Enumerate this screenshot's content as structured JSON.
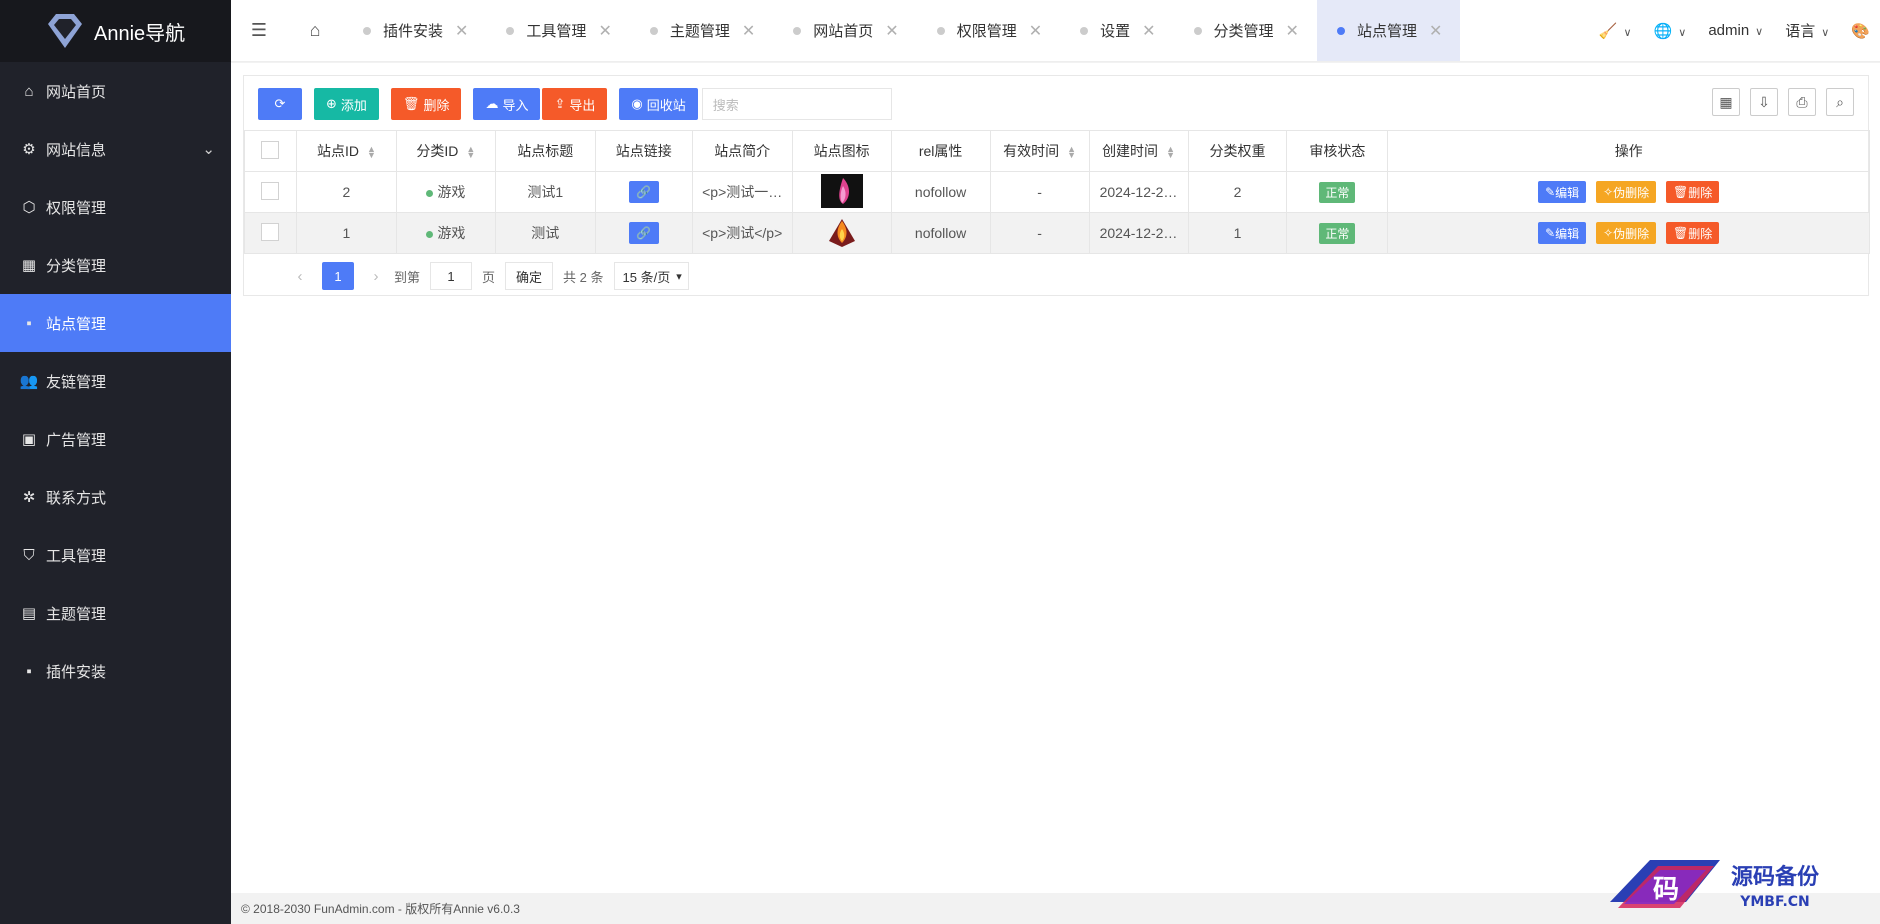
{
  "app": {
    "title": "Annie导航"
  },
  "sidebar": {
    "items": [
      {
        "label": "网站首页",
        "icon": "home-icon"
      },
      {
        "label": "网站信息",
        "icon": "gear-icon"
      },
      {
        "label": "权限管理",
        "icon": "cube-icon"
      },
      {
        "label": "分类管理",
        "icon": "apps-icon"
      },
      {
        "label": "站点管理",
        "icon": "windows-icon",
        "active": true
      },
      {
        "label": "友链管理",
        "icon": "users-icon"
      },
      {
        "label": "广告管理",
        "icon": "image-icon"
      },
      {
        "label": "联系方式",
        "icon": "star-icon"
      },
      {
        "label": "工具管理",
        "icon": "shield-icon"
      },
      {
        "label": "主题管理",
        "icon": "layout-icon"
      },
      {
        "label": "插件安装",
        "icon": "windows-icon"
      }
    ]
  },
  "tabs": [
    "插件安装",
    "工具管理",
    "主题管理",
    "网站首页",
    "权限管理",
    "设置",
    "分类管理",
    "站点管理"
  ],
  "header": {
    "user": "admin",
    "lang": "语言"
  },
  "toolbar": {
    "add": "添加",
    "delete": "删除",
    "import": "导入",
    "export": "导出",
    "recycle": "回收站",
    "search_placeholder": "搜索"
  },
  "table": {
    "columns": [
      "站点ID",
      "分类ID",
      "站点标题",
      "站点链接",
      "站点简介",
      "站点图标",
      "rel属性",
      "有效时间",
      "创建时间",
      "分类权重",
      "审核状态",
      "操作"
    ],
    "rows": [
      {
        "id": "2",
        "category": "游戏",
        "title": "测试1",
        "intro": "<p>测试一…",
        "rel": "nofollow",
        "valid": "-",
        "created": "2024-12-2…",
        "weight": "2",
        "status": "正常"
      },
      {
        "id": "1",
        "category": "游戏",
        "title": "测试",
        "intro": "<p>测试</p>",
        "rel": "nofollow",
        "valid": "-",
        "created": "2024-12-2…",
        "weight": "1",
        "status": "正常"
      }
    ],
    "actions": {
      "edit": "编辑",
      "soft_delete": "伪删除",
      "delete": "删除"
    }
  },
  "pager": {
    "current": "1",
    "goto": "到第",
    "page_value": "1",
    "page_unit": "页",
    "confirm": "确定",
    "total": "共 2 条",
    "per_page": "15 条/页"
  },
  "footer": {
    "text": "© 2018-2030 FunAdmin.com - 版权所有Annie v6.0.3"
  },
  "watermark": {
    "text": "源码备份",
    "url": "YMBF.CN",
    "glyph": "码"
  },
  "colors": {
    "primary": "#4e7bf7",
    "teal": "#16b9a4",
    "danger": "#f55a29",
    "warning": "#f5a623",
    "success": "#5fb878",
    "sidebar": "#20222a"
  }
}
